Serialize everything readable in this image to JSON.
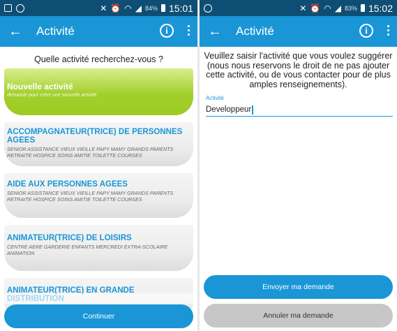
{
  "left": {
    "status": {
      "battery": "84%",
      "time": "15:01"
    },
    "title": "Activité",
    "question": "Quelle activité recherchez-vous ?",
    "cards": [
      {
        "title": "Nouvelle activité",
        "sub": "demande pour créer une nouvelle activité"
      },
      {
        "title": "ACCOMPAGNATEUR(TRICE) DE PERSONNES AGEES",
        "sub": "SENIOR ASSISTANCE VIEUX VIEILLE PAPY MAMY GRANDS PARENTS RETRAITE HOSPICE SOINS AMITIE TOILETTE COURSES"
      },
      {
        "title": "AIDE AUX PERSONNES AGEES",
        "sub": "SENIOR ASSISTANCE VIEUX VIEILLE PAPY MAMY GRANDS PARENTS RETRAITE HOSPICE SOINS AMITIE TOILETTE COURSES"
      },
      {
        "title": "ANIMATEUR(TRICE) DE LOISIRS",
        "sub": "CENTRE AERE GARDERIE ENFANTS MERCREDI EXTRA-SCOLAIRE ANIMATION"
      },
      {
        "title": "ANIMATEUR(TRICE) EN GRANDE DISTRIBUTION",
        "sub": ""
      }
    ],
    "continue_label": "Continuer"
  },
  "right": {
    "status": {
      "battery": "83%",
      "time": "15:02"
    },
    "title": "Activité",
    "intro": "Veuillez saisir l'activité que vous voulez suggérer (nous nous reservons le droit de ne pas ajouter cette activité, ou de vous contacter pour de plus amples renseignements).",
    "field_label": "Activité",
    "field_value": "Developpeur",
    "send_label": "Envoyer ma demande",
    "cancel_label": "Annuler ma demande"
  },
  "colors": {
    "accent": "#1a96d6",
    "statusbar": "#0e4e74",
    "new_card": "#9ccb22",
    "cancel": "#c7c7c7"
  },
  "icons": [
    "back-arrow-icon",
    "info-icon",
    "overflow-menu-icon",
    "wifi-icon",
    "signal-icon",
    "battery-icon",
    "alarm-icon",
    "mute-icon"
  ]
}
